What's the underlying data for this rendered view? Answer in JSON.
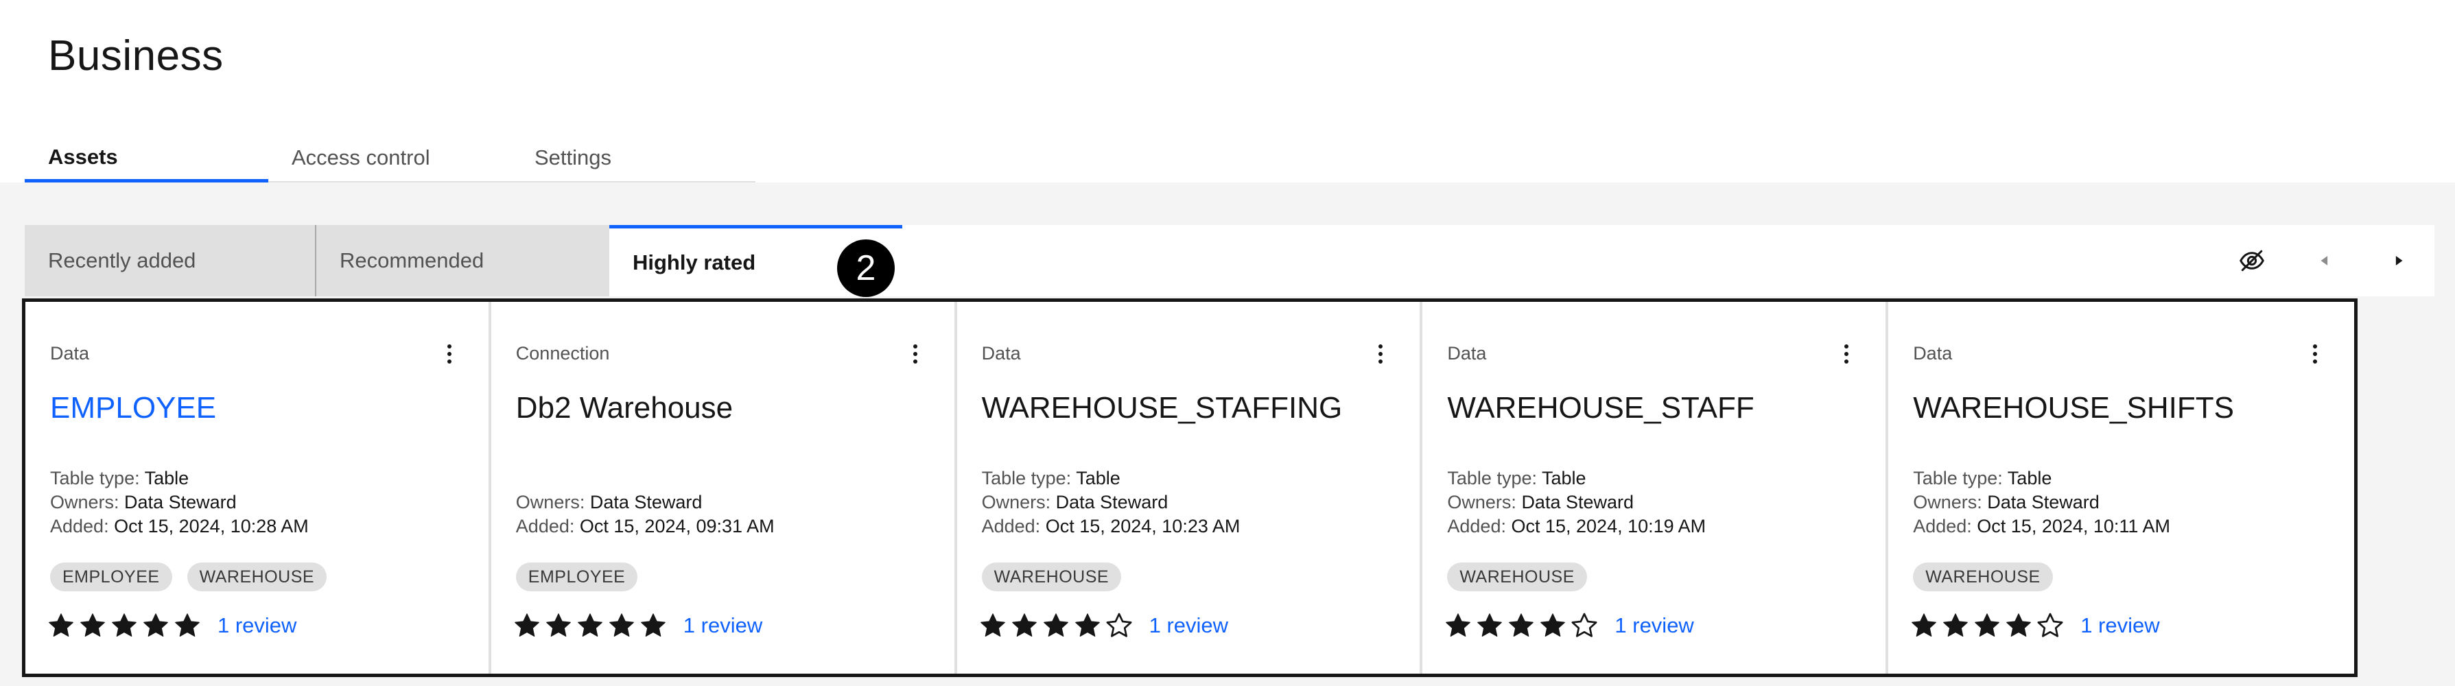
{
  "page": {
    "title": "Business"
  },
  "main_tabs": [
    {
      "label": "Assets",
      "active": true
    },
    {
      "label": "Access control",
      "active": false
    },
    {
      "label": "Settings",
      "active": false
    }
  ],
  "sub_tabs": [
    {
      "label": "Recently added",
      "active": false
    },
    {
      "label": "Recommended",
      "active": false
    },
    {
      "label": "Highly rated",
      "active": true
    }
  ],
  "step_badge": "2",
  "toolbar": {
    "icons": [
      "eye-off-icon",
      "caret-left-icon",
      "caret-right-icon"
    ]
  },
  "labels": {
    "table_type": "Table type:",
    "owners": "Owners:",
    "added": "Added:"
  },
  "cards": [
    {
      "type": "Data",
      "title": "EMPLOYEE",
      "title_is_link": true,
      "table_type": "Table",
      "owners": "Data Steward",
      "added": "Oct 15, 2024, 10:28 AM",
      "tags": [
        "EMPLOYEE",
        "WAREHOUSE"
      ],
      "rating": 5,
      "rating_max": 5,
      "reviews": "1 review"
    },
    {
      "type": "Connection",
      "title": "Db2 Warehouse",
      "title_is_link": false,
      "table_type": null,
      "owners": "Data Steward",
      "added": "Oct 15, 2024, 09:31 AM",
      "tags": [
        "EMPLOYEE"
      ],
      "rating": 5,
      "rating_max": 5,
      "reviews": "1 review"
    },
    {
      "type": "Data",
      "title": "WAREHOUSE_STAFFING",
      "title_is_link": false,
      "table_type": "Table",
      "owners": "Data Steward",
      "added": "Oct 15, 2024, 10:23 AM",
      "tags": [
        "WAREHOUSE"
      ],
      "rating": 4,
      "rating_max": 5,
      "reviews": "1 review"
    },
    {
      "type": "Data",
      "title": "WAREHOUSE_STAFF",
      "title_is_link": false,
      "table_type": "Table",
      "owners": "Data Steward",
      "added": "Oct 15, 2024, 10:19 AM",
      "tags": [
        "WAREHOUSE"
      ],
      "rating": 4,
      "rating_max": 5,
      "reviews": "1 review"
    },
    {
      "type": "Data",
      "title": "WAREHOUSE_SHIFTS",
      "title_is_link": false,
      "table_type": "Table",
      "owners": "Data Steward",
      "added": "Oct 15, 2024, 10:11 AM",
      "tags": [
        "WAREHOUSE"
      ],
      "rating": 4,
      "rating_max": 5,
      "reviews": "1 review"
    }
  ],
  "colors": {
    "accent": "#0f62fe",
    "text": "#161616",
    "muted": "#525252",
    "tag_bg": "#e0e0e0",
    "content_bg": "#f4f4f4"
  }
}
